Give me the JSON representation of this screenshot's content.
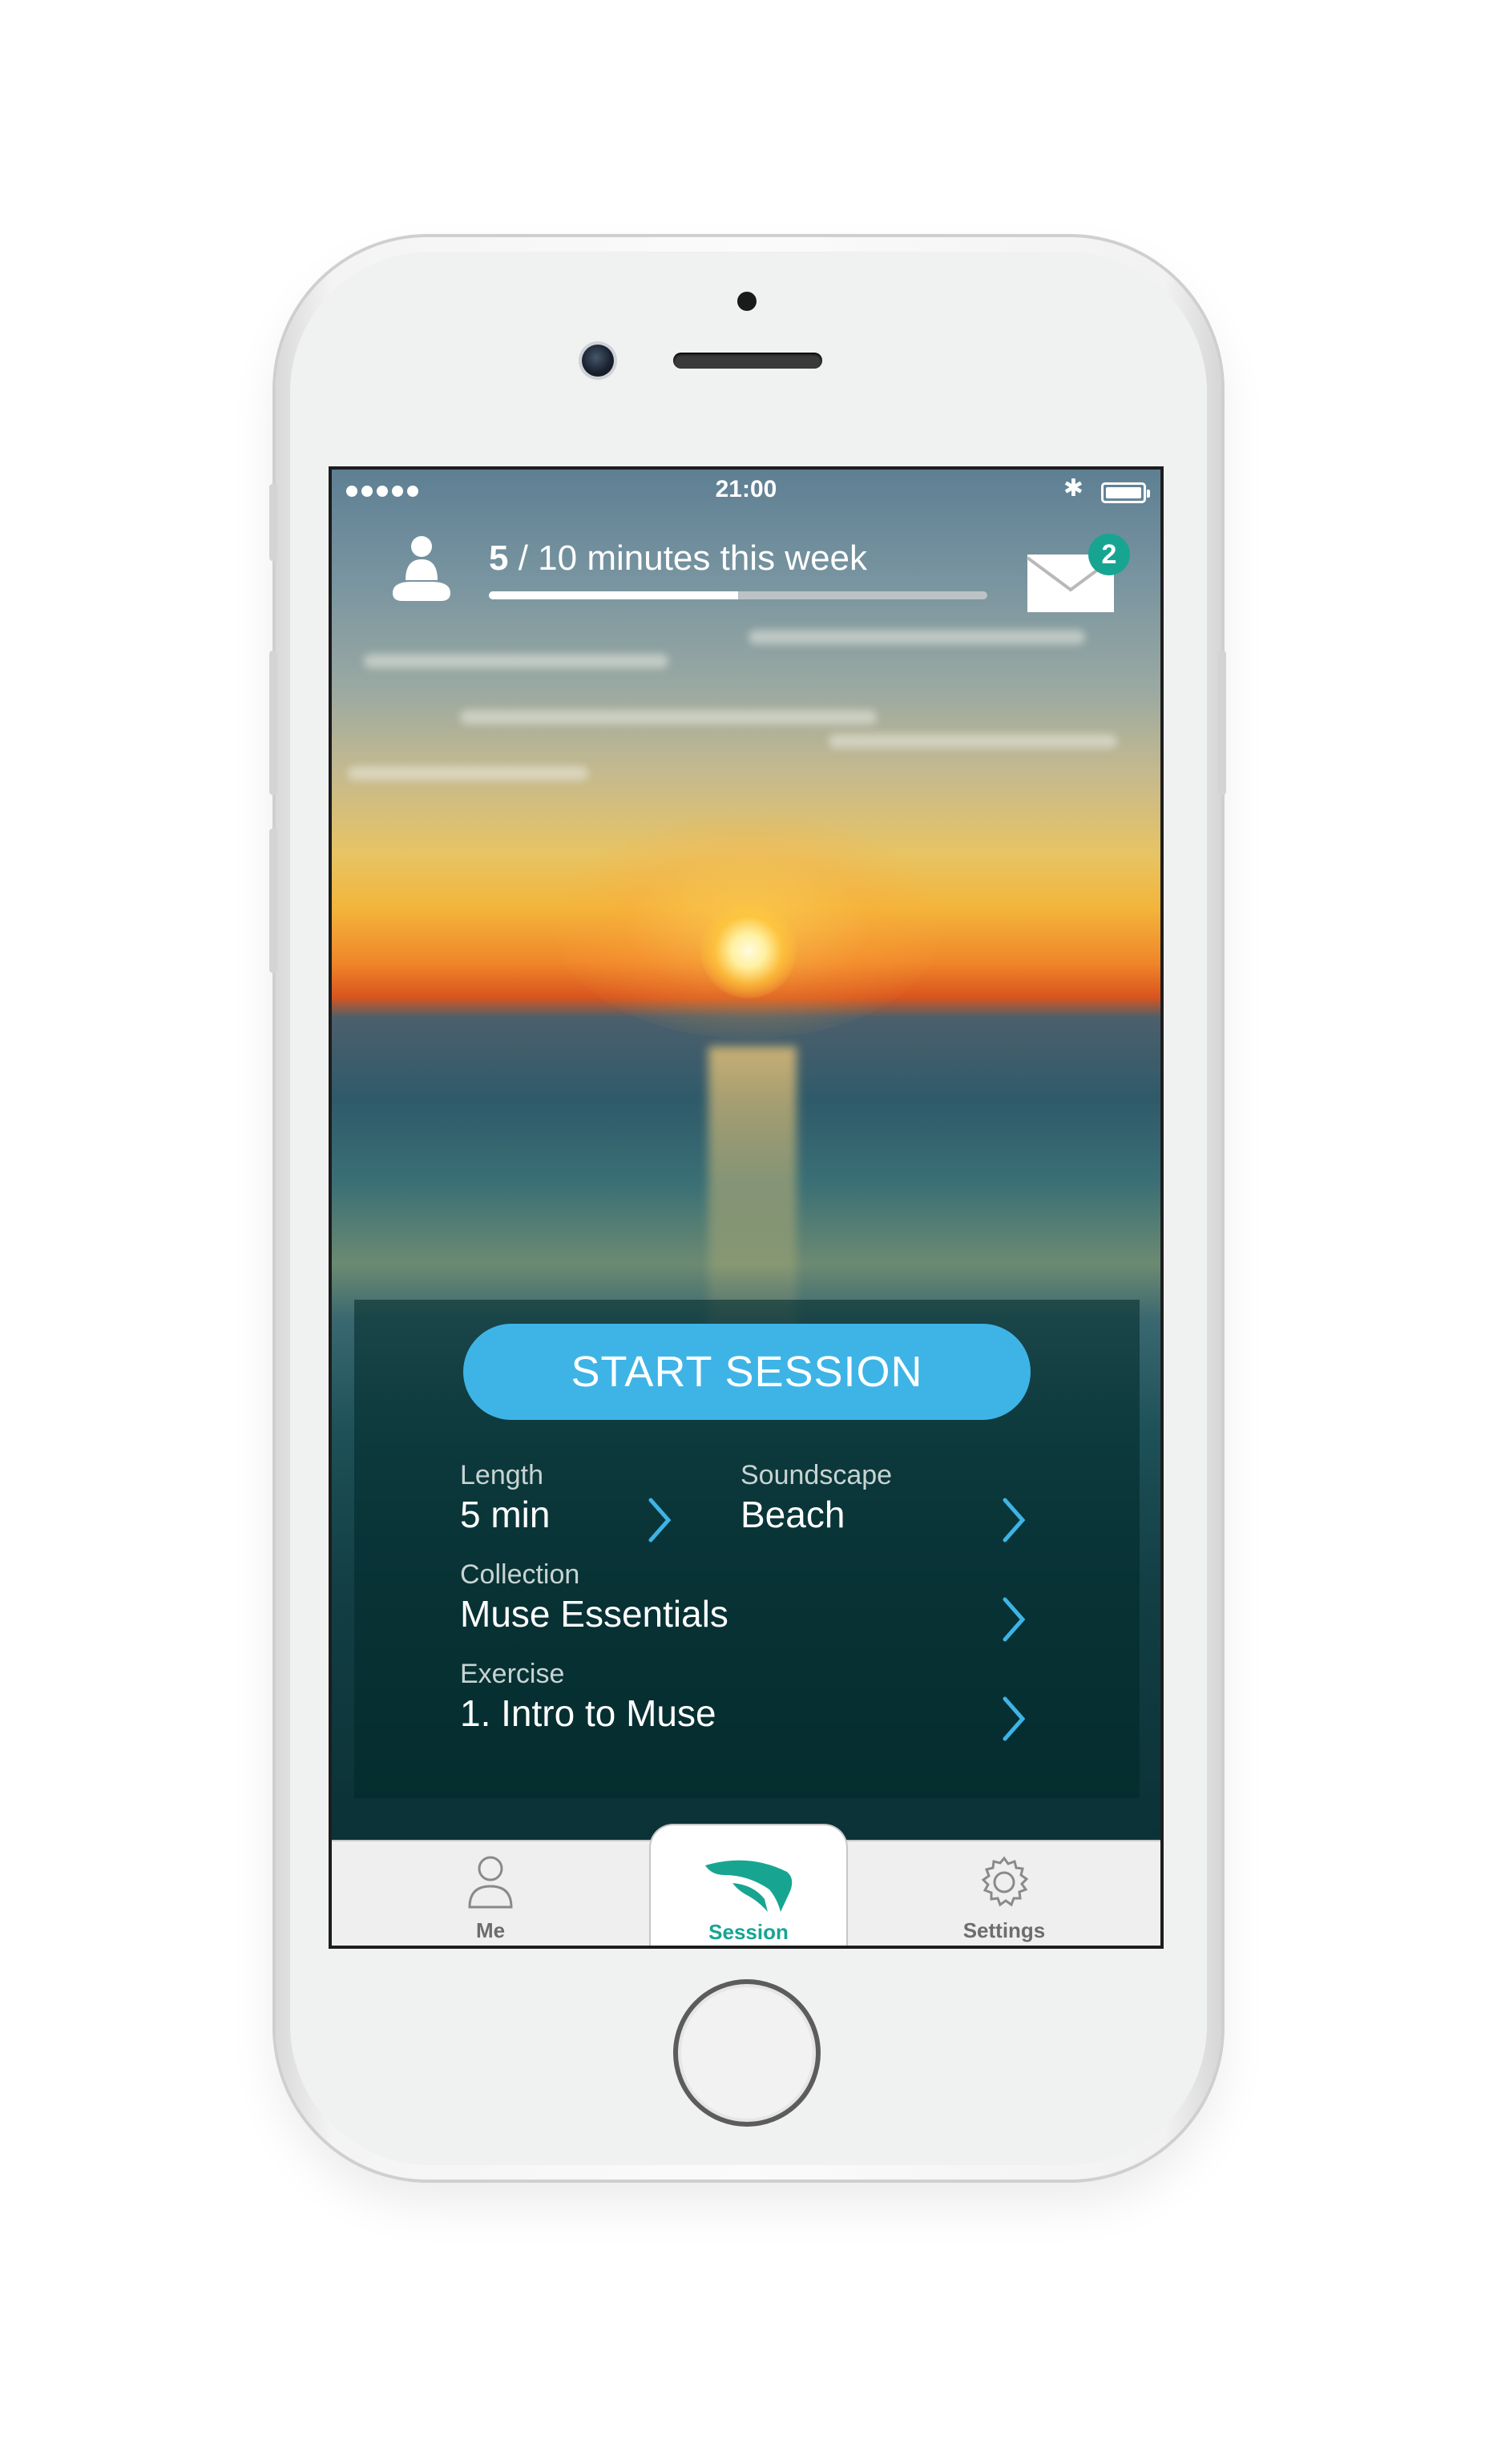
{
  "status_bar": {
    "time": "21:00"
  },
  "progress": {
    "current": "5",
    "rest": " / 10 minutes this week",
    "fraction": 0.5
  },
  "messages": {
    "badge_count": "2"
  },
  "start_button": {
    "label": "START SESSION"
  },
  "options": {
    "length": {
      "label": "Length",
      "value": "5 min"
    },
    "soundscape": {
      "label": "Soundscape",
      "value": "Beach"
    },
    "collection": {
      "label": "Collection",
      "value": "Muse Essentials"
    },
    "exercise": {
      "label": "Exercise",
      "value": "1. Intro to Muse"
    }
  },
  "tabs": [
    {
      "label": "Me",
      "icon": "person-icon"
    },
    {
      "label": "Session",
      "icon": "muse-logo-icon"
    },
    {
      "label": "Settings",
      "icon": "gear-icon"
    }
  ],
  "colors": {
    "accent": "#3eb4e6",
    "teal": "#17a592"
  }
}
